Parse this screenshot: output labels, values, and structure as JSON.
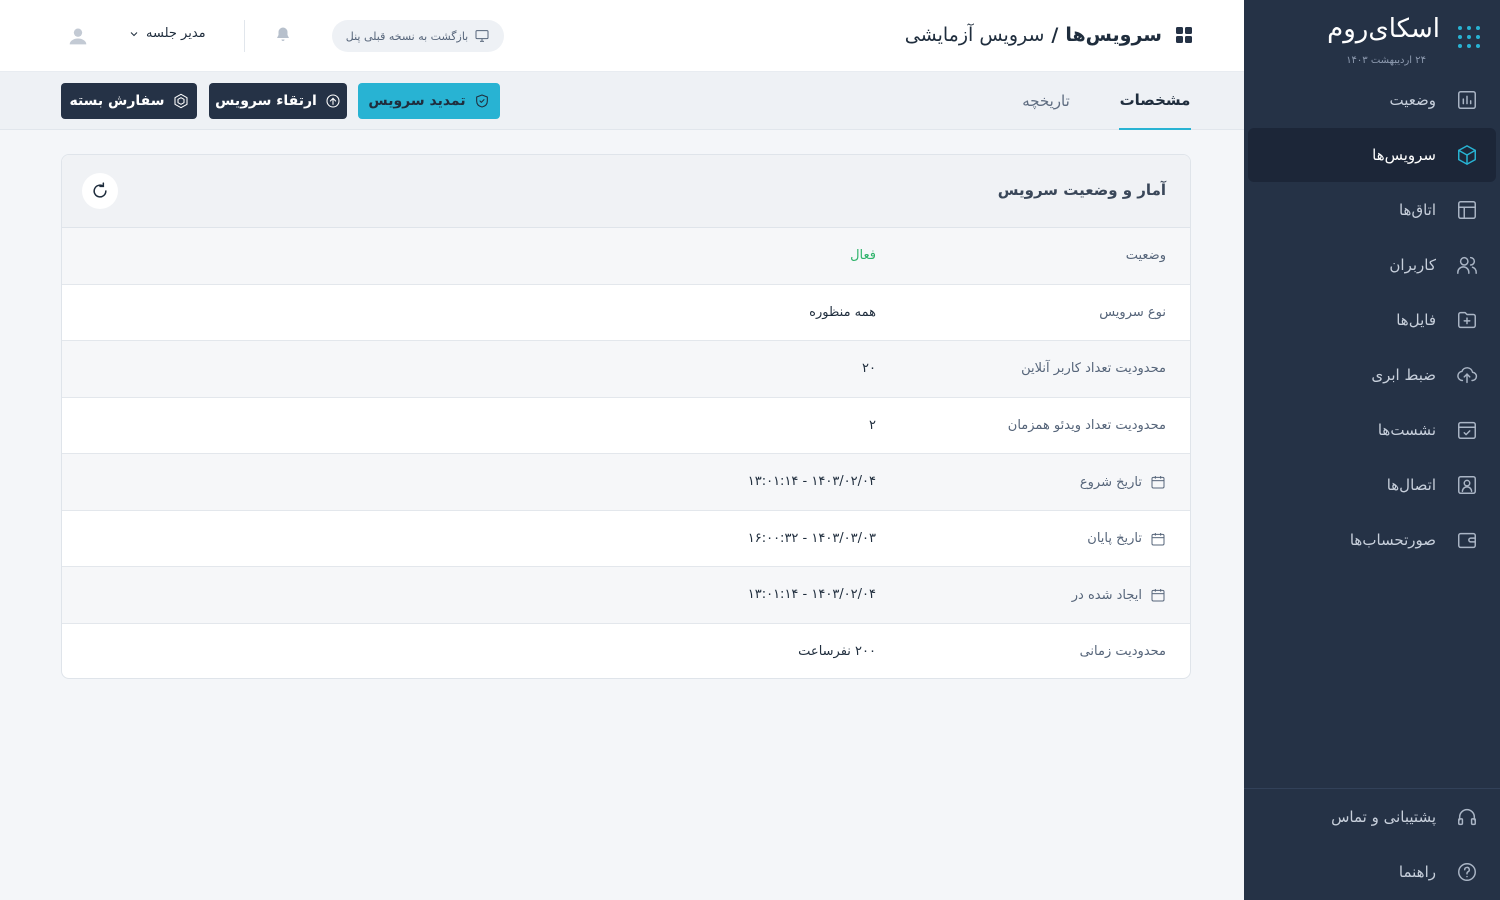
{
  "brand": {
    "name": "اسکای‌روم",
    "date": "۲۴ اردیبهشت ۱۴۰۳"
  },
  "sidebar": {
    "items": [
      {
        "label": "وضعیت",
        "icon": "chart-icon"
      },
      {
        "label": "سرویس‌ها",
        "icon": "cube-icon",
        "active": true
      },
      {
        "label": "اتاق‌ها",
        "icon": "layout-icon"
      },
      {
        "label": "کاربران",
        "icon": "users-icon"
      },
      {
        "label": "فایل‌ها",
        "icon": "folder-plus-icon"
      },
      {
        "label": "ضبط ابری",
        "icon": "cloud-upload-icon"
      },
      {
        "label": "نشست‌ها",
        "icon": "calendar-check-icon"
      },
      {
        "label": "اتصال‌ها",
        "icon": "contact-icon"
      },
      {
        "label": "صورتحساب‌ها",
        "icon": "wallet-icon"
      }
    ],
    "bottom": [
      {
        "label": "پشتیبانی و تماس",
        "icon": "headset-icon"
      },
      {
        "label": "راهنما",
        "icon": "help-icon"
      }
    ]
  },
  "header": {
    "title_main": "سرویس‌ها",
    "title_sep": "/",
    "title_sub": "سرویس آزمایشی",
    "old_panel_label": "بازگشت به نسخه قبلی پنل",
    "user_name": "مدیر جلسه"
  },
  "tabs": {
    "specs": "مشخصات",
    "history": "تاریخچه"
  },
  "actions": {
    "renew": "تمدید سرویس",
    "upgrade": "ارتقاء سرویس",
    "order": "سفارش بسته"
  },
  "card": {
    "title": "آمار و وضعیت سرویس",
    "rows": [
      {
        "label": "وضعیت",
        "value": "فعال"
      },
      {
        "label": "نوع سرویس",
        "value": "همه منظوره"
      },
      {
        "label": "محدودیت تعداد کاربر آنلاین",
        "value": "۲۰"
      },
      {
        "label": "محدودیت تعداد ویدئو همزمان",
        "value": "۲"
      },
      {
        "label": "تاریخ شروع",
        "value": "۱۴۰۳/۰۲/۰۴ - ۱۳:۰۱:۱۴"
      },
      {
        "label": "تاریخ پایان",
        "value": "۱۴۰۳/۰۳/۰۳ - ۱۶:۰۰:۳۲"
      },
      {
        "label": "ایجاد شده در",
        "value": "۱۴۰۳/۰۲/۰۴ - ۱۳:۰۱:۱۴"
      },
      {
        "label": "محدودیت زمانی",
        "value": "۲۰۰ نفرساعت"
      }
    ]
  },
  "colors": {
    "sidebar": "#253246",
    "accent": "#28b3d3",
    "status_active": "#2fb36b"
  }
}
